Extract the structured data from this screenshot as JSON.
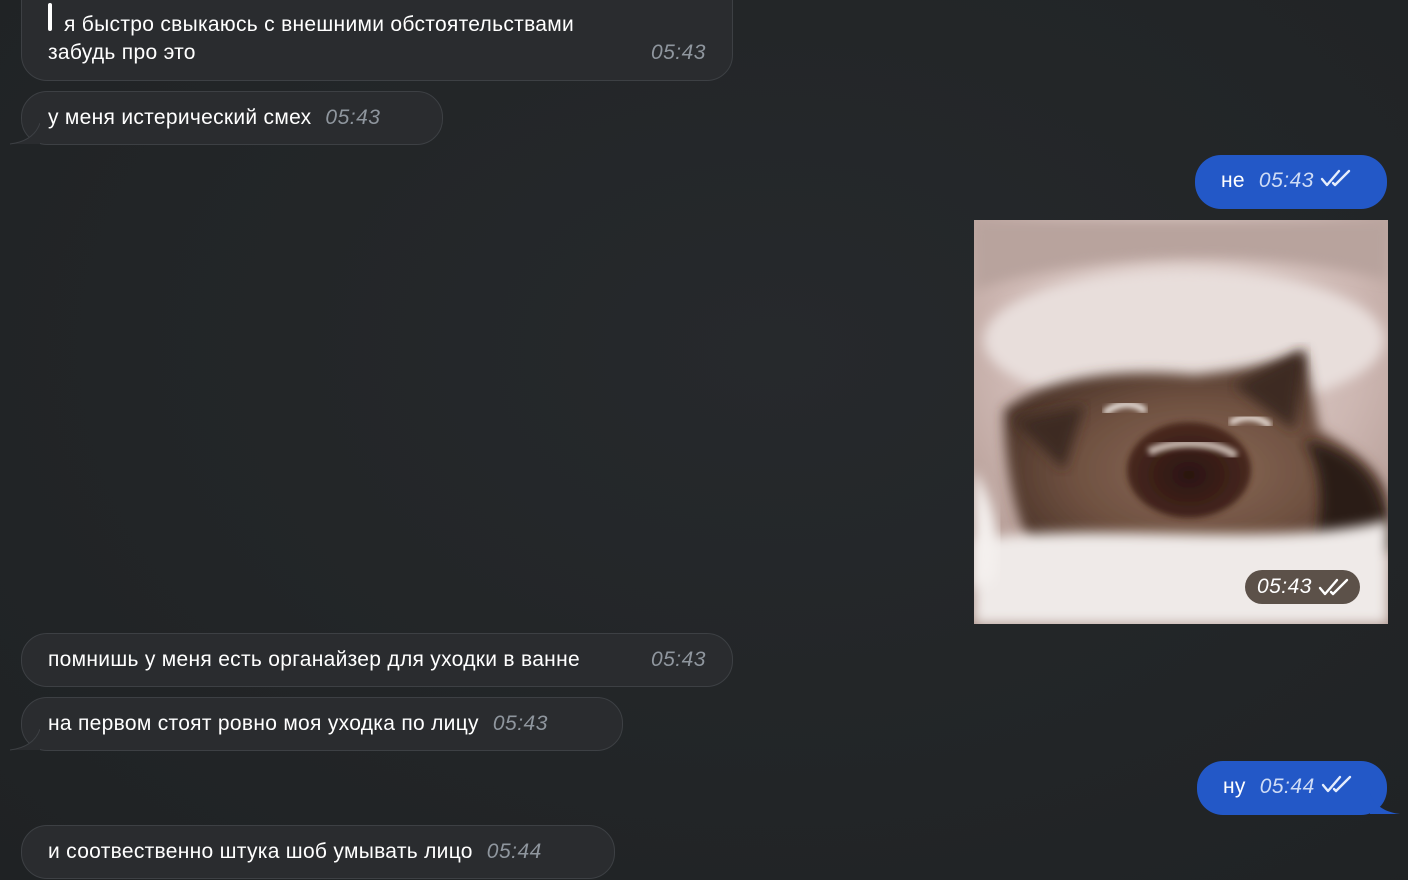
{
  "messages": [
    {
      "quote": "я быстро свыкаюсь с внешними обстоятельствами",
      "text": "забудь про это",
      "time": "05:43",
      "direction": "in"
    },
    {
      "text": "у меня истерический смех",
      "time": "05:43",
      "direction": "in"
    },
    {
      "text": "не",
      "time": "05:43",
      "direction": "out",
      "status": "read"
    },
    {
      "image": "crying-cat-meme",
      "time": "05:43",
      "direction": "out",
      "status": "read"
    },
    {
      "text": "помнишь у меня есть органайзер для уходки в ванне",
      "time": "05:43",
      "direction": "in"
    },
    {
      "text": "на первом стоят ровно моя уходка по лицу",
      "time": "05:43",
      "direction": "in"
    },
    {
      "text": "ну",
      "time": "05:44",
      "direction": "out",
      "status": "read"
    },
    {
      "text": "и соотвественно штука шоб умывать лицо",
      "time": "05:44",
      "direction": "in"
    }
  ],
  "colors": {
    "background": "#222527",
    "incoming_bubble": "#2a2c2f",
    "outgoing_bubble": "#2358c7",
    "timestamp_incoming": "#8f969e"
  }
}
